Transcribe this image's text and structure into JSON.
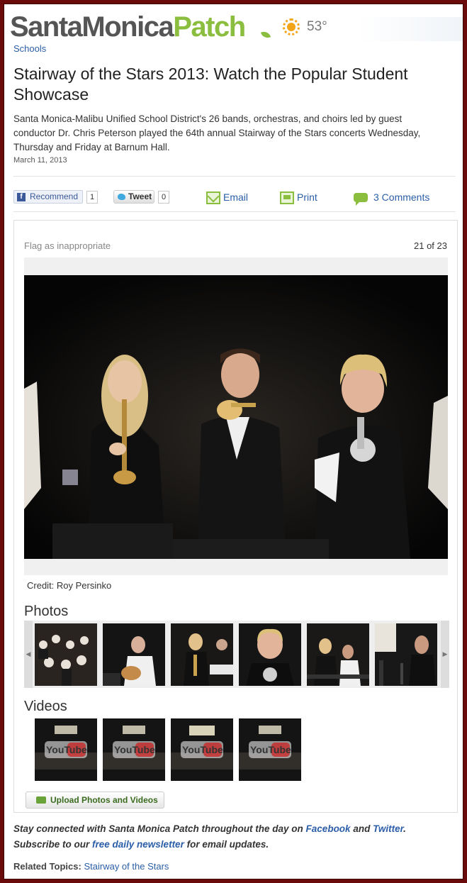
{
  "header": {
    "logo_city": "SantaMonica",
    "logo_brand": "Patch",
    "temperature": "53°",
    "weather_icon": "sun-icon"
  },
  "breadcrumb": "Schools",
  "article": {
    "title": "Stairway of the Stars 2013: Watch the Popular Student Showcase",
    "summary": "Santa Monica-Malibu Unified School District's 26 bands, orchestras, and choirs led by guest conductor Dr. Chris Peterson played the 64th annual Stairway of the Stars concerts Wednesday, Thursday and Friday at Barnum Hall.",
    "date": "March 11, 2013"
  },
  "share": {
    "recommend_label": "Recommend",
    "recommend_count": "1",
    "tweet_label": "Tweet",
    "tweet_count": "0",
    "email_label": "Email",
    "print_label": "Print",
    "comments_label": "3 Comments"
  },
  "gallery": {
    "flag_label": "Flag as inappropriate",
    "pager": "21 of 23",
    "credit": "Credit: Roy Persinko",
    "photos_title": "Photos",
    "videos_title": "Videos",
    "upload_label": "Upload Photos and Videos",
    "video_overlay_text": "YouTube"
  },
  "footer": {
    "promo_part1": "Stay connected with Santa Monica Patch throughout the day on ",
    "facebook": "Facebook",
    "and": " and ",
    "twitter": "Twitter",
    "period": ".",
    "promo_part2": "Subscribe to our ",
    "newsletter": "free daily newsletter",
    "promo_part3": " for email updates.",
    "related_label": "Related Topics:",
    "related_topic": "Stairway of the Stars"
  },
  "colors": {
    "brand_green": "#8bbd3f",
    "link_blue": "#2b5ea7",
    "frame_maroon": "#6b0a0a"
  }
}
